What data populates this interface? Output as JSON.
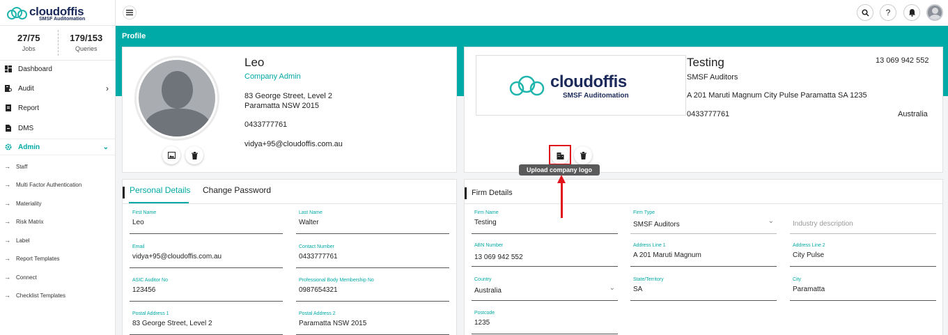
{
  "brand": {
    "name_a": "cloud",
    "name_b": "offis",
    "tagline": "SMSF Auditomation",
    "accent": "#00aaa6"
  },
  "stats": {
    "jobs_value": "27/75",
    "jobs_label": "Jobs",
    "queries_value": "179/153",
    "queries_label": "Queries"
  },
  "sidebar": {
    "items": [
      {
        "label": "Dashboard",
        "icon": "dashboard-icon"
      },
      {
        "label": "Audit",
        "icon": "audit-icon"
      },
      {
        "label": "Report",
        "icon": "report-icon"
      },
      {
        "label": "DMS",
        "icon": "dms-icon"
      },
      {
        "label": "Admin",
        "icon": "gear-icon"
      }
    ],
    "sub_items": [
      "Staff",
      "Multi Factor Authentication",
      "Materiality",
      "Risk Matrix",
      "Label",
      "Report Templates",
      "Connect",
      "Checklist Templates"
    ]
  },
  "topbar": {
    "search_icon": "search-icon",
    "help_glyph": "?",
    "bell_icon": "bell-icon"
  },
  "page_title": "Profile",
  "user": {
    "name": "Leo",
    "role": "Company Admin",
    "address_line1": "83 George Street, Level 2",
    "address_line2": "Paramatta NSW 2015",
    "phone": "0433777761",
    "email": "vidya+95@cloudoffis.com.au"
  },
  "firm": {
    "name": "Testing",
    "abn": "13 069 942 552",
    "type": "SMSF Auditors",
    "address": "A 201 Maruti Magnum City Pulse Paramatta SA 1235",
    "phone": "0433777761",
    "country": "Australia",
    "tooltip": "Upload company logo"
  },
  "personal_tabs": {
    "active": "Personal Details",
    "other": "Change Password"
  },
  "personal_fields": [
    {
      "label": "First Name",
      "value": "Leo"
    },
    {
      "label": "Last Name",
      "value": "Walter"
    },
    {
      "label": "Email",
      "value": "vidya+95@cloudoffis.com.au"
    },
    {
      "label": "Contact Number",
      "value": "0433777761"
    },
    {
      "label": "ASIC Auditor No",
      "value": "123456"
    },
    {
      "label": "Professional Body Membership No",
      "value": "0987654321"
    },
    {
      "label": "Postal Address 1",
      "value": "83 George Street, Level 2"
    },
    {
      "label": "Postal Address 2",
      "value": "Paramatta NSW 2015"
    }
  ],
  "firm_section_title": "Firm Details",
  "firm_fields": [
    {
      "label": "Firm Name",
      "value": "Testing"
    },
    {
      "label": "Firm Type",
      "value": "SMSF Auditors"
    },
    {
      "label": "",
      "placeholder": "Industry description"
    },
    {
      "label": "ABN Number",
      "value": "13 069 942 552"
    },
    {
      "label": "Address Line 1",
      "value": "A 201 Maruti Magnum"
    },
    {
      "label": "Address Line 2",
      "value": "City Pulse"
    },
    {
      "label": "Country",
      "value": "Australia"
    },
    {
      "label": "State/Territory",
      "value": "SA"
    },
    {
      "label": "City",
      "value": "Paramatta"
    },
    {
      "label": "Postcode",
      "value": "1235"
    }
  ]
}
